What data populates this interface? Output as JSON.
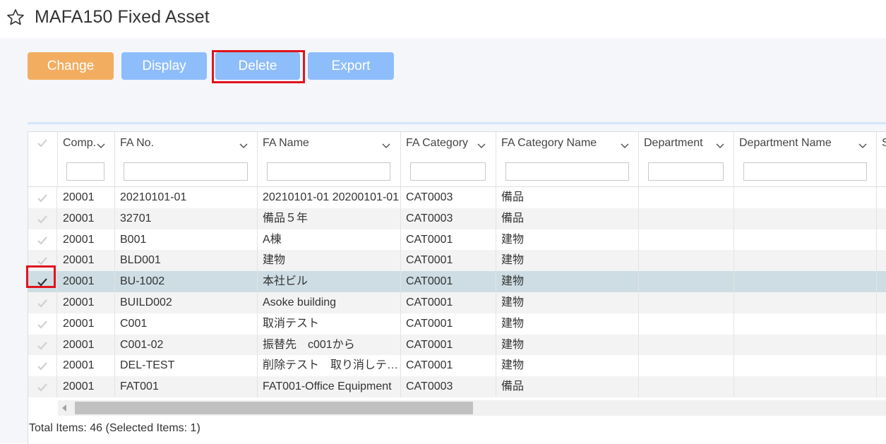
{
  "header": {
    "title": "MAFA150 Fixed Asset"
  },
  "toolbar": {
    "change_label": "Change",
    "display_label": "Display",
    "delete_label": "Delete",
    "export_label": "Export"
  },
  "grid": {
    "columns": [
      {
        "label": "Comp."
      },
      {
        "label": "FA No."
      },
      {
        "label": "FA Name"
      },
      {
        "label": "FA Category"
      },
      {
        "label": "FA Category Name"
      },
      {
        "label": "Department"
      },
      {
        "label": "Department Name"
      },
      {
        "label": "S"
      }
    ],
    "rows": [
      {
        "company": "20001",
        "fa_no": "20210101-01",
        "fa_name": "20210101-01 20200101-01",
        "fa_category": "CAT0003",
        "fa_category_name": "備品",
        "department": "",
        "department_name": "",
        "selected": false
      },
      {
        "company": "20001",
        "fa_no": "32701",
        "fa_name": "備品５年",
        "fa_category": "CAT0003",
        "fa_category_name": "備品",
        "department": "",
        "department_name": "",
        "selected": false
      },
      {
        "company": "20001",
        "fa_no": "B001",
        "fa_name": "A棟",
        "fa_category": "CAT0001",
        "fa_category_name": "建物",
        "department": "",
        "department_name": "",
        "selected": false
      },
      {
        "company": "20001",
        "fa_no": "BLD001",
        "fa_name": "建物",
        "fa_category": "CAT0001",
        "fa_category_name": "建物",
        "department": "",
        "department_name": "",
        "selected": false
      },
      {
        "company": "20001",
        "fa_no": "BU-1002",
        "fa_name": "本社ビル",
        "fa_category": "CAT0001",
        "fa_category_name": "建物",
        "department": "",
        "department_name": "",
        "selected": true
      },
      {
        "company": "20001",
        "fa_no": "BUILD002",
        "fa_name": "Asoke building",
        "fa_category": "CAT0001",
        "fa_category_name": "建物",
        "department": "",
        "department_name": "",
        "selected": false
      },
      {
        "company": "20001",
        "fa_no": "C001",
        "fa_name": "取消テスト",
        "fa_category": "CAT0001",
        "fa_category_name": "建物",
        "department": "",
        "department_name": "",
        "selected": false
      },
      {
        "company": "20001",
        "fa_no": "C001-02",
        "fa_name": "振替先　c001から",
        "fa_category": "CAT0001",
        "fa_category_name": "建物",
        "department": "",
        "department_name": "",
        "selected": false
      },
      {
        "company": "20001",
        "fa_no": "DEL-TEST",
        "fa_name": "削除テスト　取り消しテスト",
        "fa_category": "CAT0001",
        "fa_category_name": "建物",
        "department": "",
        "department_name": "",
        "selected": false
      },
      {
        "company": "20001",
        "fa_no": "FAT001",
        "fa_name": "FAT001-Office Equipment",
        "fa_category": "CAT0003",
        "fa_category_name": "備品",
        "department": "",
        "department_name": "",
        "selected": false
      }
    ]
  },
  "footer": {
    "summary": "Total Items: 46 (Selected Items: 1)"
  },
  "colors": {
    "change_button": "#f3ad61",
    "action_button": "#8ebdfb",
    "highlight": "#e0141e",
    "selected_row": "#cddde3"
  },
  "icons": {
    "favorite": "star-outline-icon",
    "check": "check-icon",
    "sort": "chevron-down-icon"
  }
}
